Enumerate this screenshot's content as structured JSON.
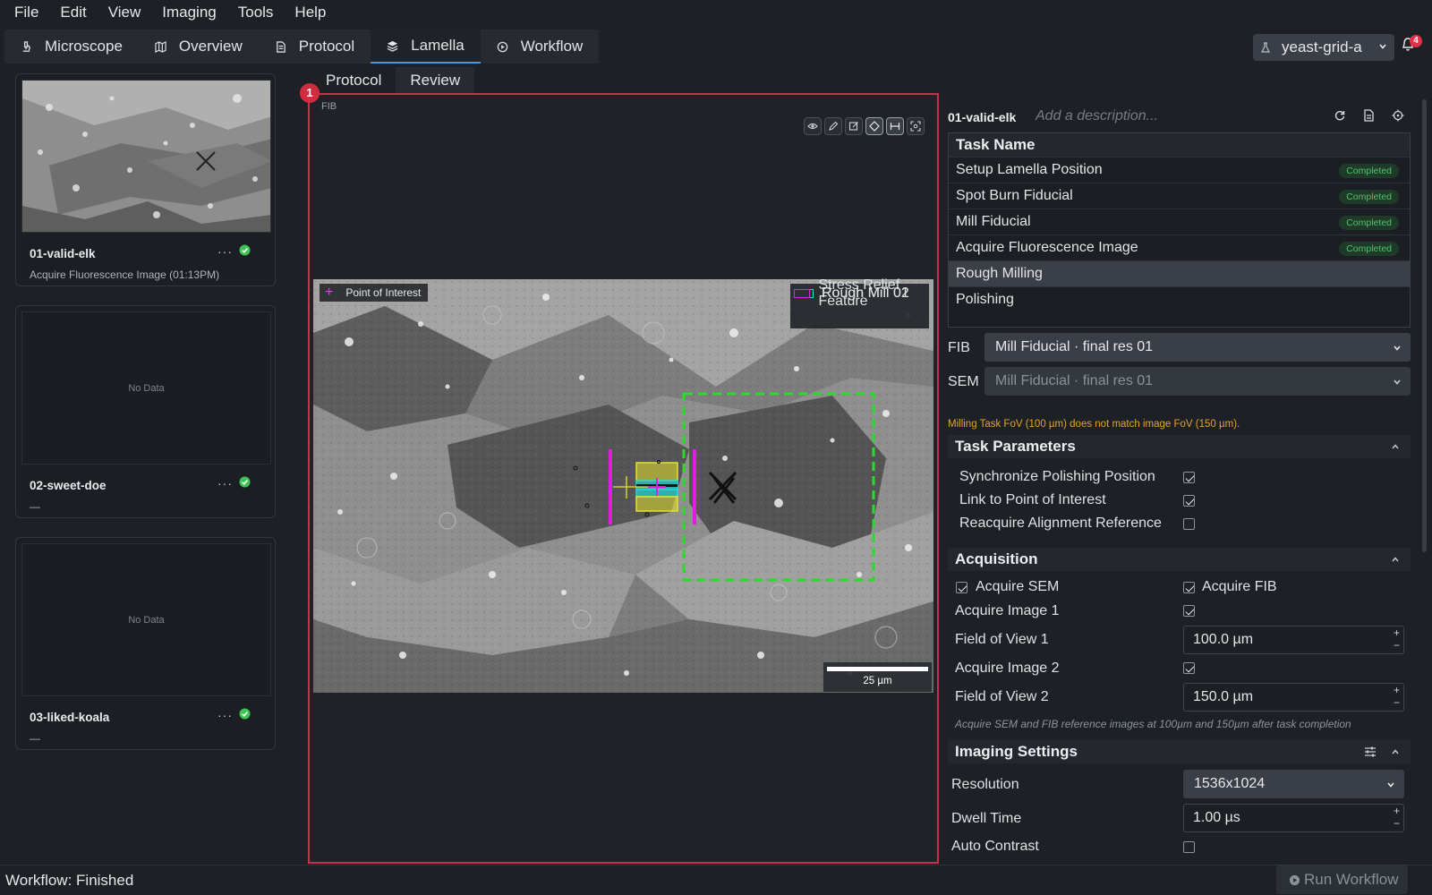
{
  "menubar": {
    "items": [
      "File",
      "Edit",
      "View",
      "Imaging",
      "Tools",
      "Help"
    ]
  },
  "main_tabs": [
    {
      "label": "Microscope",
      "icon": "microscope-icon"
    },
    {
      "label": "Overview",
      "icon": "map-icon"
    },
    {
      "label": "Protocol",
      "icon": "document-icon"
    },
    {
      "label": "Lamella",
      "icon": "layers-icon",
      "active": true
    },
    {
      "label": "Workflow",
      "icon": "play-circle-icon"
    }
  ],
  "project": {
    "name": "yeast-grid-a",
    "icon": "flask-icon"
  },
  "notifications": {
    "count": "4"
  },
  "lamellae": [
    {
      "name": "01-valid-elk",
      "subtitle": "Acquire Fluorescence Image (01:13PM)",
      "has_image": true,
      "more": "···"
    },
    {
      "name": "02-sweet-doe",
      "subtitle": "—",
      "no_data": "No Data",
      "more": "···"
    },
    {
      "name": "03-liked-koala",
      "subtitle": "—",
      "no_data": "No Data",
      "more": "···"
    }
  ],
  "center": {
    "sub_tabs": [
      "Protocol",
      "Review"
    ],
    "badge": "1",
    "viewer_label": "FIB",
    "poi_label": "Point of Interest",
    "legend": [
      {
        "label": "Rough Mill 01",
        "color": "#e6e22b"
      },
      {
        "label": "Rough Mill 02",
        "color": "#26d3d3"
      },
      {
        "label": "Stress Relief Feature",
        "color": "#e01ee0"
      }
    ],
    "scale_label": "25 µm"
  },
  "right": {
    "lamella_name": "01-valid-elk",
    "description_placeholder": "Add a description...",
    "task_header": "Task Name",
    "tasks": [
      {
        "name": "Setup Lamella Position",
        "status": "Completed"
      },
      {
        "name": "Spot Burn Fiducial",
        "status": "Completed"
      },
      {
        "name": "Mill Fiducial",
        "status": "Completed"
      },
      {
        "name": "Acquire Fluorescence Image",
        "status": "Completed"
      },
      {
        "name": "Rough Milling",
        "status": "",
        "selected": true
      },
      {
        "name": "Polishing",
        "status": ""
      }
    ],
    "fib_label": "FIB",
    "fib_value": "Mill Fiducial · final res 01",
    "sem_label": "SEM",
    "sem_value": "Mill Fiducial · final res 01",
    "warning": "Milling Task FoV (100 µm) does not match image FoV (150 µm).",
    "task_params_title": "Task Parameters",
    "task_params": [
      {
        "label": "Synchronize Polishing Position",
        "checked": true
      },
      {
        "label": "Link to Point of Interest",
        "checked": true
      },
      {
        "label": "Reacquire Alignment Reference",
        "checked": false
      }
    ],
    "acquisition_title": "Acquisition",
    "acquire_sem": "Acquire SEM",
    "acquire_fib": "Acquire FIB",
    "acquire_image_1": "Acquire Image 1",
    "fov1_label": "Field of View 1",
    "fov1_value": "100.0  µm",
    "acquire_image_2": "Acquire Image 2",
    "fov2_label": "Field of View 2",
    "fov2_value": "150.0  µm",
    "acq_hint": "Acquire SEM and FIB reference images at 100µm and 150µm after task completion",
    "imaging_title": "Imaging Settings",
    "resolution_label": "Resolution",
    "resolution_value": "1536x1024",
    "dwell_label": "Dwell Time",
    "dwell_value": "1.00 µs",
    "autocontrast_label": "Auto Contrast"
  },
  "status": {
    "text": "Workflow: Finished",
    "run_label": "Run Workflow"
  }
}
